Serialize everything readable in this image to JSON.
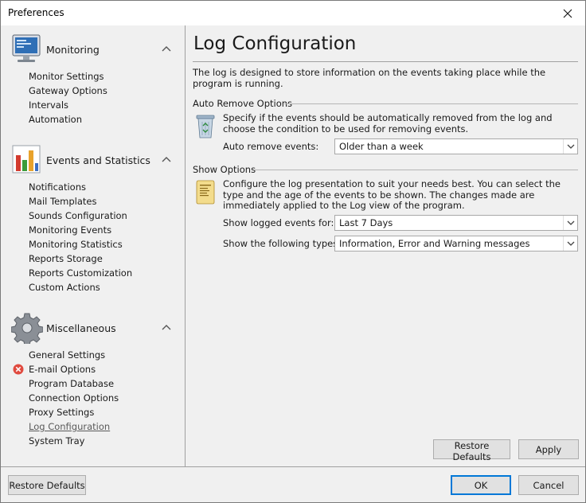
{
  "window": {
    "title": "Preferences"
  },
  "sidebar": {
    "groups": [
      {
        "title": "Monitoring",
        "items": [
          "Monitor Settings",
          "Gateway Options",
          "Intervals",
          "Automation"
        ]
      },
      {
        "title": "Events and Statistics",
        "items": [
          "Notifications",
          "Mail Templates",
          "Sounds Configuration",
          "Monitoring Events",
          "Monitoring Statistics",
          "Reports Storage",
          "Reports Customization",
          "Custom Actions"
        ]
      },
      {
        "title": "Miscellaneous",
        "items": [
          "General Settings",
          "E-mail Options",
          "Program Database",
          "Connection Options",
          "Proxy Settings",
          "Log Configuration",
          "System Tray"
        ]
      }
    ],
    "active_item": "Log Configuration",
    "error_item": "E-mail Options"
  },
  "content": {
    "title": "Log Configuration",
    "intro": "The log is designed to store information on the events taking place while the program is running.",
    "auto_remove": {
      "header": "Auto Remove Options",
      "description": "Specify if the events should be automatically removed from the log and choose the condition to be used for removing events.",
      "field_label": "Auto remove events:",
      "field_value": "Older than a week"
    },
    "show_options": {
      "header": "Show Options",
      "description": "Configure the log presentation to suit your needs best. You can select the type and the age of the events to be shown. The changes made are immediately applied to the Log view of the program.",
      "logged_label": "Show logged events for:",
      "logged_value": "Last 7 Days",
      "types_label": "Show the following types:",
      "types_value": "Information, Error and Warning messages"
    },
    "restore_defaults_label": "Restore Defaults",
    "apply_label": "Apply"
  },
  "footer": {
    "restore_defaults_label": "Restore Defaults",
    "ok_label": "OK",
    "cancel_label": "Cancel"
  },
  "colors": {
    "accent": "#0078d7",
    "error": "#e04a3f"
  }
}
